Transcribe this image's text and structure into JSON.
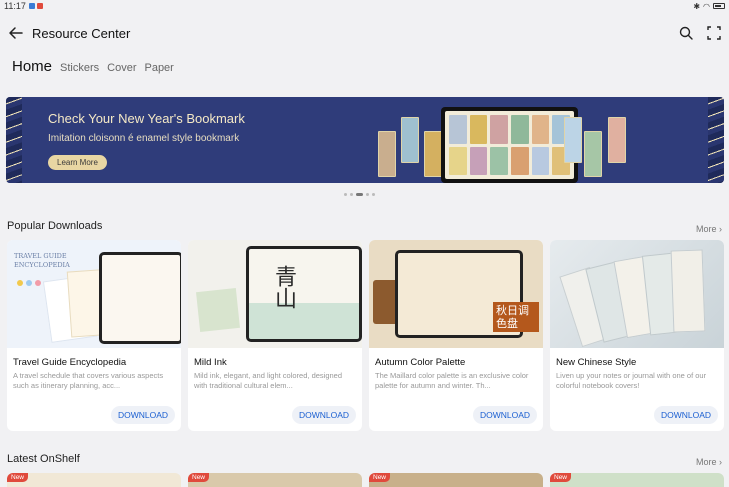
{
  "status": {
    "time": "11:17"
  },
  "header": {
    "title": "Resource Center"
  },
  "tabs": [
    {
      "label": "Home"
    },
    {
      "label": "Stickers"
    },
    {
      "label": "Cover"
    },
    {
      "label": "Paper"
    }
  ],
  "banner": {
    "title": "Check Your New Year's Bookmark",
    "subtitle": "Imitation cloisonn é enamel style bookmark",
    "button": "Learn More",
    "carousel": {
      "count": 5,
      "active": 3
    }
  },
  "popular": {
    "title": "Popular Downloads",
    "more": "More",
    "cards": [
      {
        "title": "Travel Guide Encyclopedia",
        "desc": "A travel schedule that covers various aspects such as itinerary planning, acc...",
        "button": "DOWNLOAD",
        "thumb_caption": "TRAVEL GUIDE ENCYCLOPEDIA"
      },
      {
        "title": "Mild Ink",
        "desc": "Mild ink, elegant, and light colored, designed with traditional cultural elem...",
        "button": "DOWNLOAD",
        "thumb_caption": "青山"
      },
      {
        "title": "Autumn Color Palette",
        "desc": "The Maillard color palette is an exclusive color palette for autumn and winter. Th...",
        "button": "DOWNLOAD",
        "thumb_caption": "秋日调色盘"
      },
      {
        "title": "New Chinese Style",
        "desc": "Liven up your notes or journal with one of our colorful notebook covers!",
        "button": "DOWNLOAD"
      }
    ]
  },
  "latest": {
    "title": "Latest OnShelf",
    "more": "More",
    "badges": [
      "New",
      "New",
      "New",
      "New"
    ]
  },
  "colors": {
    "accent": "#1b5fd1",
    "banner_bg": "#2f3c7a",
    "badge": "#e04a3c"
  }
}
